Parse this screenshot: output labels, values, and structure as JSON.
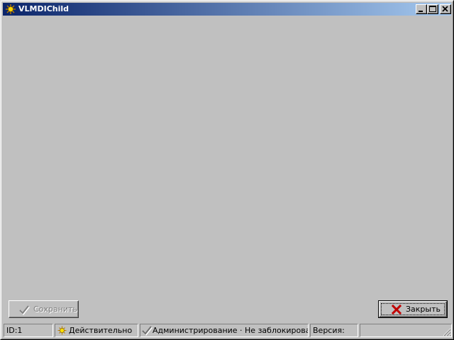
{
  "window": {
    "title": "VLMDIChild",
    "icon": "sun-icon"
  },
  "titlebar_buttons": {
    "minimize_icon": "minimize-icon",
    "maximize_icon": "maximize-icon",
    "close_icon": "close-icon"
  },
  "buttons": {
    "save": {
      "label": "Сохранить",
      "icon": "checkmark-icon",
      "enabled": false
    },
    "close": {
      "label": "Закрыть",
      "icon": "red-x-icon",
      "enabled": true
    }
  },
  "statusbar": {
    "id": "ID:1",
    "validity": "Действительно",
    "validity_icon": "sun-icon",
    "lock_status": "Администрирование · Не заблокирован",
    "lock_icon": "checkmark-icon",
    "version": "Версия:",
    "extra": ""
  },
  "colors": {
    "titlebar_start": "#0a246a",
    "titlebar_end": "#a6caf0",
    "face": "#c0c0c0",
    "close_icon_red": "#c00000"
  }
}
